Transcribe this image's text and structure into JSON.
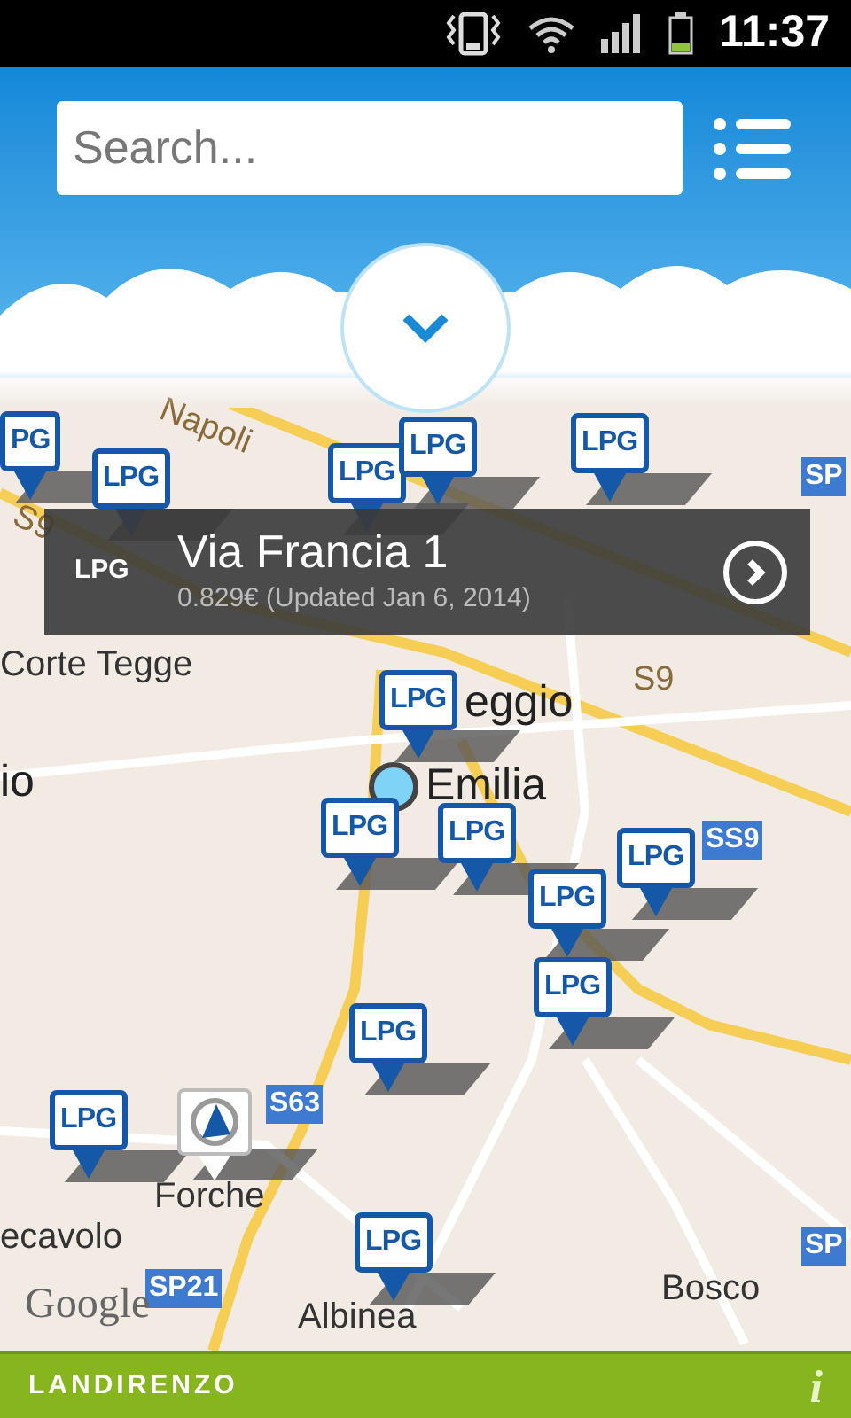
{
  "status_bar": {
    "time": "11:37"
  },
  "search": {
    "placeholder": "Search..."
  },
  "map": {
    "labels": [
      {
        "text": "Napoli",
        "kind": "road"
      },
      {
        "text": "S9",
        "kind": "road"
      },
      {
        "text": "SP",
        "kind": "shield"
      },
      {
        "text": "Corte Tegge",
        "kind": "place"
      },
      {
        "text": "S9",
        "kind": "road"
      },
      {
        "text": "eggio",
        "kind": "city"
      },
      {
        "text": "Emilia",
        "kind": "city"
      },
      {
        "text": "io",
        "kind": "city"
      },
      {
        "text": "SS9",
        "kind": "shield"
      },
      {
        "text": "S63",
        "kind": "shield"
      },
      {
        "text": "Forche",
        "kind": "place"
      },
      {
        "text": "ecavolo",
        "kind": "place"
      },
      {
        "text": "SP21",
        "kind": "shield"
      },
      {
        "text": "Albinea",
        "kind": "place"
      },
      {
        "text": "Bosco",
        "kind": "place"
      },
      {
        "text": "SP",
        "kind": "shield"
      },
      {
        "text": "Google",
        "kind": "attribution"
      }
    ],
    "pins": [
      {
        "kind": "lpg",
        "label": "PG"
      },
      {
        "kind": "lpg",
        "label": "LPG"
      },
      {
        "kind": "lpg",
        "label": "LPG"
      },
      {
        "kind": "lpg",
        "label": "LPG"
      },
      {
        "kind": "lpg",
        "label": "LPG"
      },
      {
        "kind": "lpg",
        "label": "LPG"
      },
      {
        "kind": "lpg",
        "label": "LPG"
      },
      {
        "kind": "lpg",
        "label": "LPG"
      },
      {
        "kind": "lpg",
        "label": "LPG"
      },
      {
        "kind": "lpg",
        "label": "LPG"
      },
      {
        "kind": "lpg",
        "label": "LPG"
      },
      {
        "kind": "lpg",
        "label": "LPG"
      },
      {
        "kind": "lpg",
        "label": "LPG"
      },
      {
        "kind": "lpg",
        "label": "LPG"
      },
      {
        "kind": "logo"
      }
    ]
  },
  "popup": {
    "badge": "LPG",
    "title": "Via Francia 1",
    "subtitle": "0.829€ (Updated Jan 6, 2014)"
  },
  "footer": {
    "brand": "LANDIRENZO",
    "info": "i"
  }
}
